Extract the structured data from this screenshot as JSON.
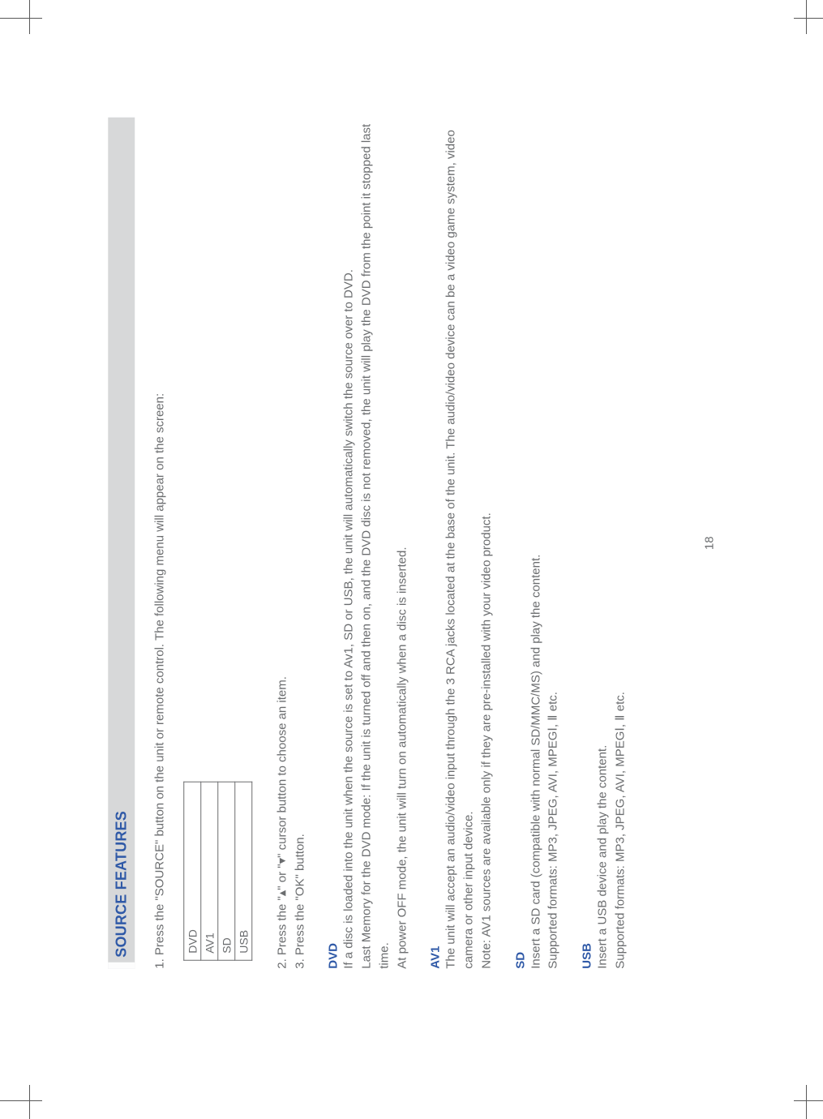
{
  "title": "SOURCE FEATURES",
  "step1": "1. Press the \"SOURCE\" button on the unit or remote control. The following menu will appear on the screen:",
  "menu": [
    "DVD",
    "AV1",
    "SD",
    "USB"
  ],
  "step2": "2. Press the \"▴\" or \"▾\" cursor button to choose an item.",
  "step3": "3. Press the \"OK\" button.",
  "dvd": {
    "head": "DVD",
    "p1": "If a disc is loaded into the unit when the source is set to Av1, SD or USB, the unit will automatically switch the source over to DVD.",
    "p2": "Last Memory for the DVD mode: If the unit is turned off and then on, and the DVD disc is not removed, the unit will play the DVD from the point it stopped last time.",
    "p3": "At power OFF mode, the unit will turn on automatically when a disc is inserted."
  },
  "av1": {
    "head": "AV1",
    "p1": "The unit will accept an audio/video input through the 3 RCA jacks located at the base of the unit. The audio/video device can be a video game system, video camera or other input device.",
    "p2": "Note: AV1 sources are available only if they are pre-installed with your video product."
  },
  "sd": {
    "head": "SD",
    "p1": "Insert a SD card (compatible with normal SD/MMC/MS) and play the content.",
    "p2": "Supported formats: MP3, JPEG, AVI, MPEGⅠ, Ⅱ etc."
  },
  "usb": {
    "head": "USB",
    "p1": "Insert a USB device and play the content.",
    "p2": "Supported formats: MP3, JPEG, AVI, MPEGⅠ, Ⅱ etc."
  },
  "page_number": "18"
}
